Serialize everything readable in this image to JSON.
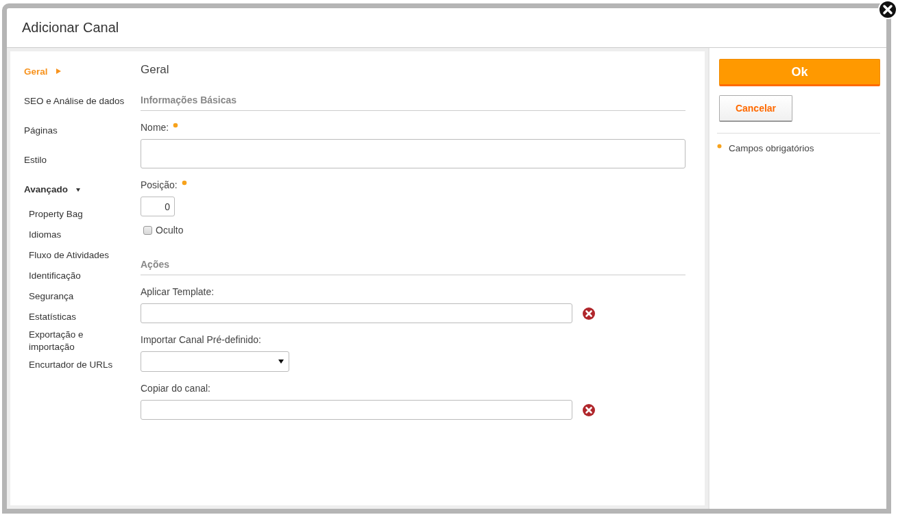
{
  "dialog": {
    "title": "Adicionar Canal"
  },
  "sidebar": {
    "items": [
      {
        "kind": "link",
        "label": "Geral",
        "selected": true
      },
      {
        "kind": "link",
        "label": "SEO e Análise de dados",
        "selected": false
      },
      {
        "kind": "link",
        "label": "Páginas",
        "selected": false
      },
      {
        "kind": "link",
        "label": "Estilo",
        "selected": false
      },
      {
        "kind": "group",
        "label": "Avançado",
        "selected": false,
        "expanded": true,
        "children": [
          {
            "label": "Property Bag",
            "selected": false
          },
          {
            "label": "Idiomas",
            "selected": false
          },
          {
            "label": "Fluxo de Atividades",
            "selected": false
          },
          {
            "label": "Identificação",
            "selected": false
          },
          {
            "label": "Segurança",
            "selected": false
          },
          {
            "label": "Estatísticas",
            "selected": false
          },
          {
            "label": "Exportação e importação",
            "selected": false
          },
          {
            "label": "Encurtador de URLs",
            "selected": false
          }
        ]
      }
    ]
  },
  "main": {
    "heading": "Geral",
    "sections": [
      {
        "title": "Informações Básicas",
        "fields": [
          {
            "kind": "text",
            "label": "Nome:",
            "required": true
          },
          {
            "kind": "number",
            "label": "Posição:",
            "required": true,
            "value": "0"
          },
          {
            "kind": "checkbox",
            "label": "Oculto",
            "checked": false
          }
        ]
      },
      {
        "title": "Ações",
        "fields": [
          {
            "kind": "clearable",
            "label": "Aplicar Template:",
            "required": false
          },
          {
            "kind": "select",
            "label": "Importar Canal Pré-definido:",
            "required": false
          },
          {
            "kind": "clearable",
            "label": "Copiar do canal:",
            "required": false
          }
        ]
      }
    ]
  },
  "actions": {
    "buttons": [
      {
        "kind": "primary",
        "label": "Ok"
      },
      {
        "kind": "secondary",
        "label": "Cancelar"
      }
    ],
    "legend": "Campos obrigatórios"
  }
}
